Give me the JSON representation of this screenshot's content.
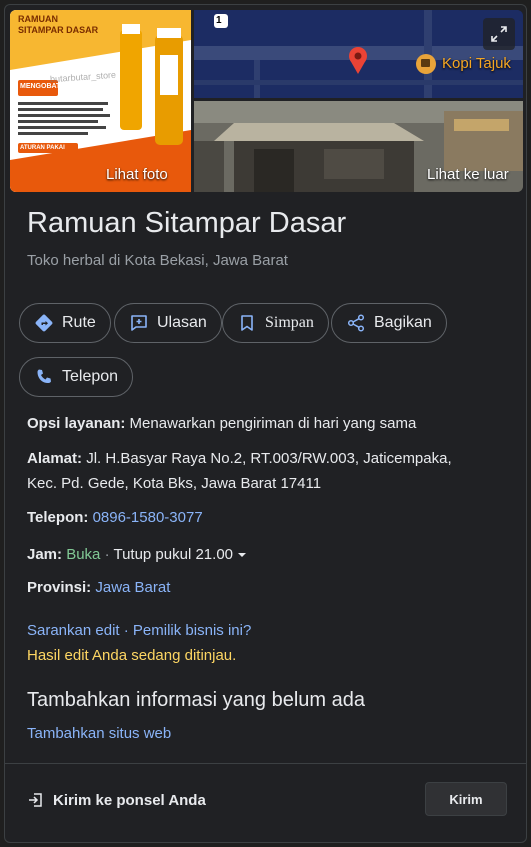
{
  "photos": {
    "left_caption": "Lihat foto",
    "right_caption": "Lihat ke luar",
    "map_place": "Kopi Tajuk",
    "map_road_badge": "1",
    "product_brand_line1": "RAMUAN",
    "product_brand_line2": "SITAMPAR DASAR",
    "product_tag": "MENGOBATI",
    "product_tag2": "ATURAN PAKAI",
    "watermark": "butarbutar_store"
  },
  "place": {
    "name": "Ramuan Sitampar Dasar",
    "category": "Toko herbal di Kota Bekasi, Jawa Barat"
  },
  "actions": [
    {
      "label": "Rute",
      "icon": "directions-icon"
    },
    {
      "label": "Ulasan",
      "icon": "review-icon"
    },
    {
      "label": "Simpan",
      "icon": "bookmark-icon"
    },
    {
      "label": "Bagikan",
      "icon": "share-icon"
    },
    {
      "label": "Telepon",
      "icon": "phone-icon"
    }
  ],
  "info": {
    "service_label": "Opsi layanan:",
    "service_value": "Menawarkan pengiriman di hari yang sama",
    "address_label": "Alamat:",
    "address_line1": "Jl. H.Basyar Raya No.2, RT.003/RW.003, Jaticempaka,",
    "address_line2": "Kec. Pd. Gede, Kota Bks, Jawa Barat 17411",
    "phone_label": "Telepon:",
    "phone_value": "0896-1580-3077",
    "hours_label": "Jam:",
    "hours_status": "Buka",
    "hours_sep": " · ",
    "hours_close": "Tutup pukul 21.00",
    "province_label": "Provinsi:",
    "province_value": "Jawa Barat"
  },
  "edit": {
    "suggest": "Sarankan edit",
    "sep": " · ",
    "owner": "Pemilik bisnis ini?",
    "pending": "Hasil edit Anda sedang ditinjau."
  },
  "missing": {
    "heading": "Tambahkan informasi yang belum ada",
    "add_website": "Tambahkan situs web"
  },
  "send": {
    "label": "Kirim ke ponsel Anda",
    "button": "Kirim"
  },
  "colors": {
    "link": "#8ab4f8",
    "open": "#81c995",
    "pending": "#fdd663",
    "pin": "#ea4335"
  }
}
